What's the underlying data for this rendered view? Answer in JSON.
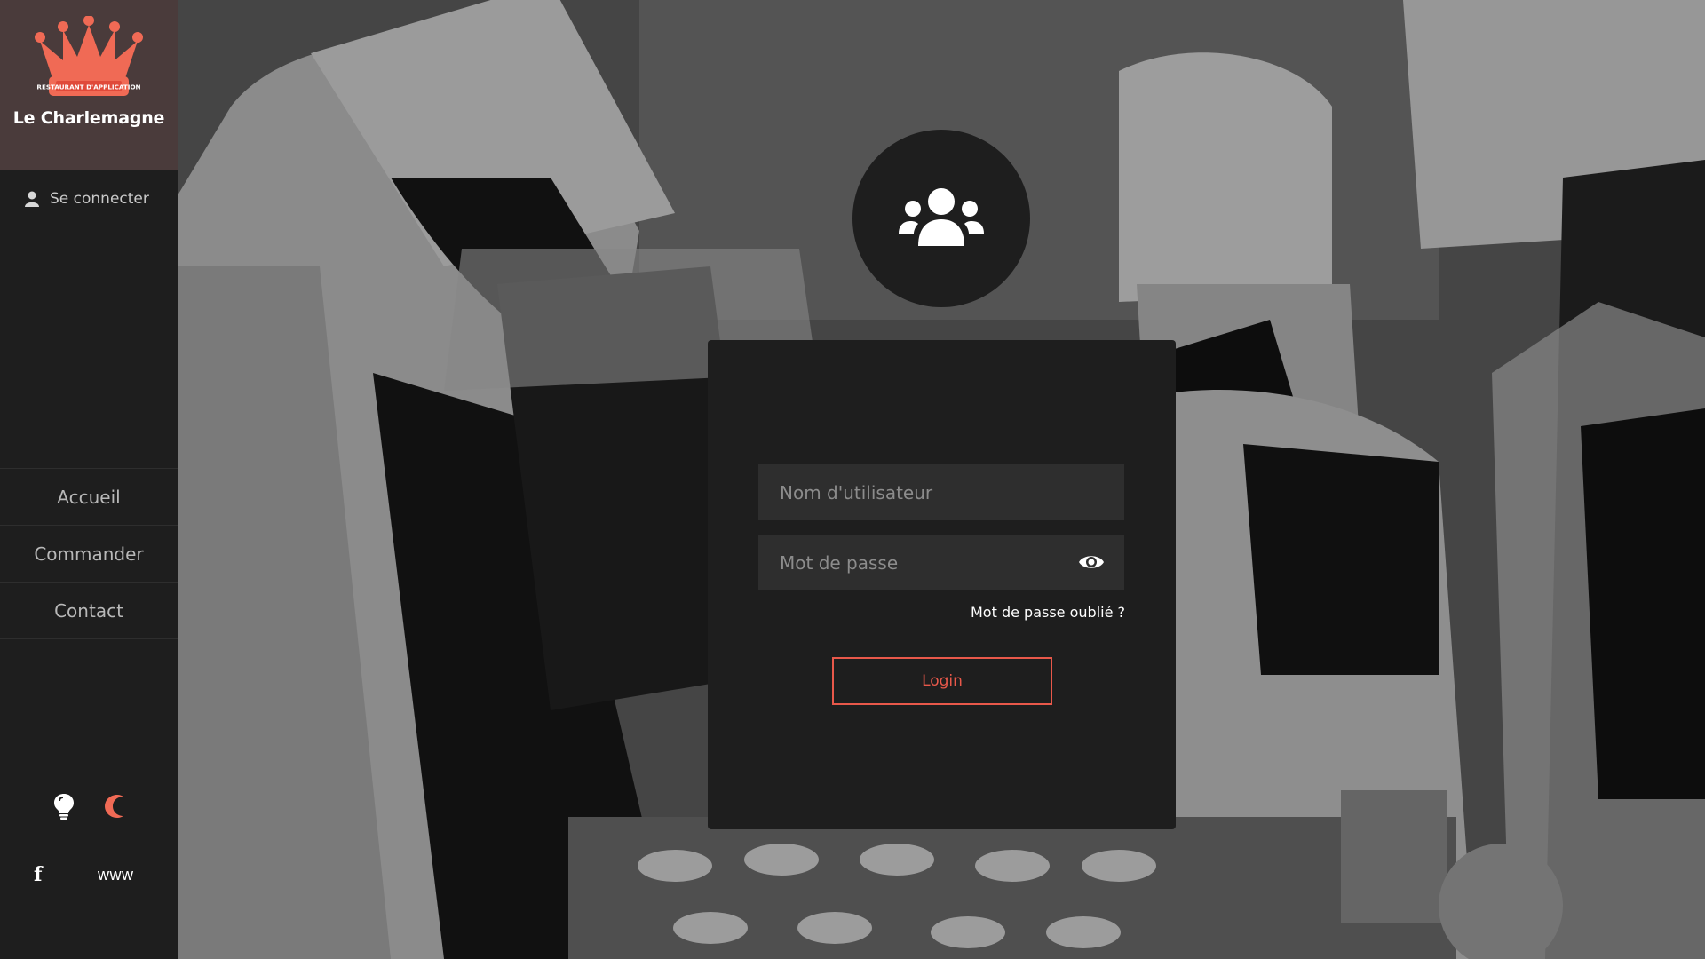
{
  "brand": {
    "name": "Le Charlemagne",
    "badge_text": "RESTAURANT D'APPLICATION",
    "accent_color": "#f06a55"
  },
  "sidebar": {
    "login_label": "Se connecter",
    "nav": [
      {
        "label": "Accueil"
      },
      {
        "label": "Commander"
      },
      {
        "label": "Contact"
      }
    ],
    "theme_icons": [
      "lightbulb-icon",
      "moon-icon"
    ],
    "social": {
      "facebook": "f",
      "website": "www"
    }
  },
  "login": {
    "username_placeholder": "Nom d'utilisateur",
    "password_placeholder": "Mot de passe",
    "forgot_label": "Mot de passe oublié ?",
    "submit_label": "Login"
  },
  "colors": {
    "accent": "#e8584a",
    "sidebar_bg": "#1e1e1e",
    "brand_bg": "#4a3b3b",
    "input_bg": "#2e2e2e"
  }
}
